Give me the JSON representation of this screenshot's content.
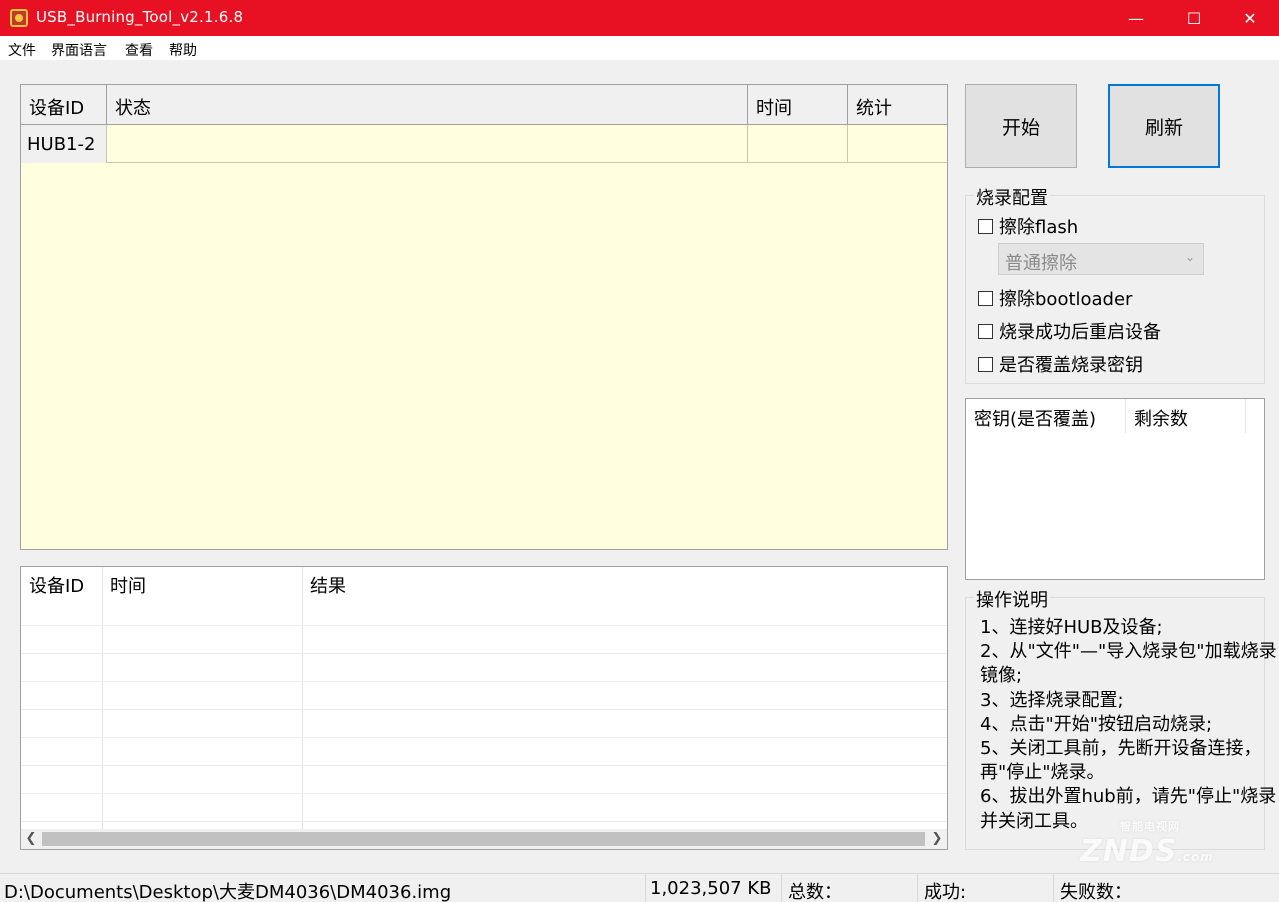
{
  "window": {
    "title": "USB_Burning_Tool_v2.1.6.8",
    "minimize_glyph": "—",
    "maximize_glyph": "☐",
    "close_glyph": "✕"
  },
  "menu": [
    "文件",
    "界面语言",
    "查看",
    "帮助"
  ],
  "device_table": {
    "headers": [
      "设备ID",
      "状态",
      "时间",
      "统计"
    ],
    "rows": [
      {
        "id": "HUB1-2",
        "status": "",
        "time": "",
        "stats": ""
      }
    ]
  },
  "log_table": {
    "headers": [
      "设备ID",
      "时间",
      "结果"
    ],
    "rows": []
  },
  "buttons": {
    "start": "开始",
    "refresh": "刷新"
  },
  "burn_config": {
    "title": "烧录配置",
    "erase_flash": {
      "label": "擦除flash",
      "checked": false
    },
    "erase_mode": {
      "value": "普通擦除",
      "disabled": true
    },
    "erase_bootloader": {
      "label": "擦除bootloader",
      "checked": false
    },
    "reboot_after": {
      "label": "烧录成功后重启设备",
      "checked": false
    },
    "overwrite_key": {
      "label": "是否覆盖烧录密钥",
      "checked": false
    }
  },
  "key_table": {
    "headers": [
      "密钥(是否覆盖)",
      "剩余数"
    ]
  },
  "instructions": {
    "title": "操作说明",
    "lines": [
      "1、连接好HUB及设备;",
      "2、从\"文件\"—\"导入烧录包\"加载烧录镜像;",
      "3、选择烧录配置;",
      "4、点击\"开始\"按钮启动烧录;",
      "5、关闭工具前，先断开设备连接，再\"停止\"烧录。",
      "6、拔出外置hub前，请先\"停止\"烧录并关闭工具。"
    ]
  },
  "watermark": {
    "main": "ZNDS",
    "suffix": ".com",
    "top": "智能电视网"
  },
  "statusbar": {
    "path": "D:\\Documents\\Desktop\\大麦DM4036\\DM4036.img",
    "size": "1,023,507 KB",
    "total": "总数：",
    "success": "成功:",
    "fail": "失败数："
  }
}
